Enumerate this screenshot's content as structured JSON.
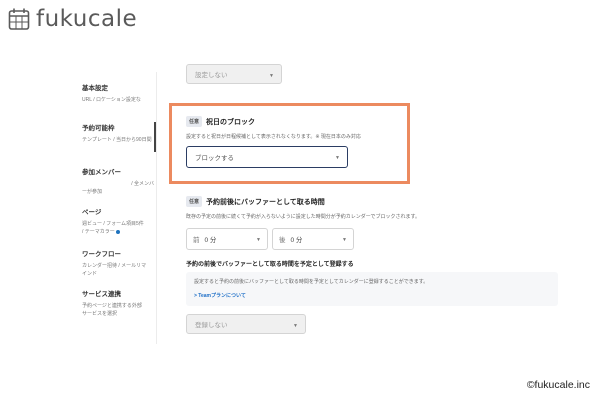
{
  "brand": {
    "name": "fukucale",
    "logo_icon": "calendar-icon"
  },
  "sidebar": {
    "items": [
      {
        "title": "基本設定",
        "desc": "URL / ロケーション設定な"
      },
      {
        "title": "予約可能枠",
        "desc": "テンプレート / 当日から90日間"
      },
      {
        "title": "参加メンバー",
        "desc": "/ 全メンバ",
        "desc2": "ーが参加"
      },
      {
        "title": "ページ",
        "desc": "週ビュー / フォーム項目5件",
        "desc2": "/ テーマカラー"
      },
      {
        "title": "ワークフロー",
        "desc": "カレンダー招待 / メールリマ",
        "desc2": "インド"
      },
      {
        "title": "サービス連携",
        "desc": "予約ページと連携する外部",
        "desc2": "サービスを選択"
      }
    ]
  },
  "top_select": {
    "value": "設定しない"
  },
  "holiday_block": {
    "badge": "任意",
    "title": "祝日のブロック",
    "desc": "設定すると祝日が日程候補として表示されなくなります。※ 現在日本のみ対応",
    "select_value": "ブロックする"
  },
  "buffer": {
    "badge": "任意",
    "title": "予約前後にバッファーとして取る時間",
    "desc": "既存の予定の前後に続くて予約が入らないように設定した時間分が予約カレンダーでブロックされます。",
    "before_prefix": "前",
    "before_value": "0 分",
    "after_prefix": "後",
    "after_value": "0 分"
  },
  "register": {
    "title": "予約の前後でバッファーとして取る時間を予定として登録する",
    "info": "設定すると予約の前後にバッファーとして取る時間を予定としてカレンダーに登録することができます。",
    "link": "> Teamプランについて",
    "select_value": "登録しない"
  },
  "copyright": "©fukucale.inc",
  "colors": {
    "highlight": "#ec8a5f",
    "link": "#1e6fc7"
  }
}
